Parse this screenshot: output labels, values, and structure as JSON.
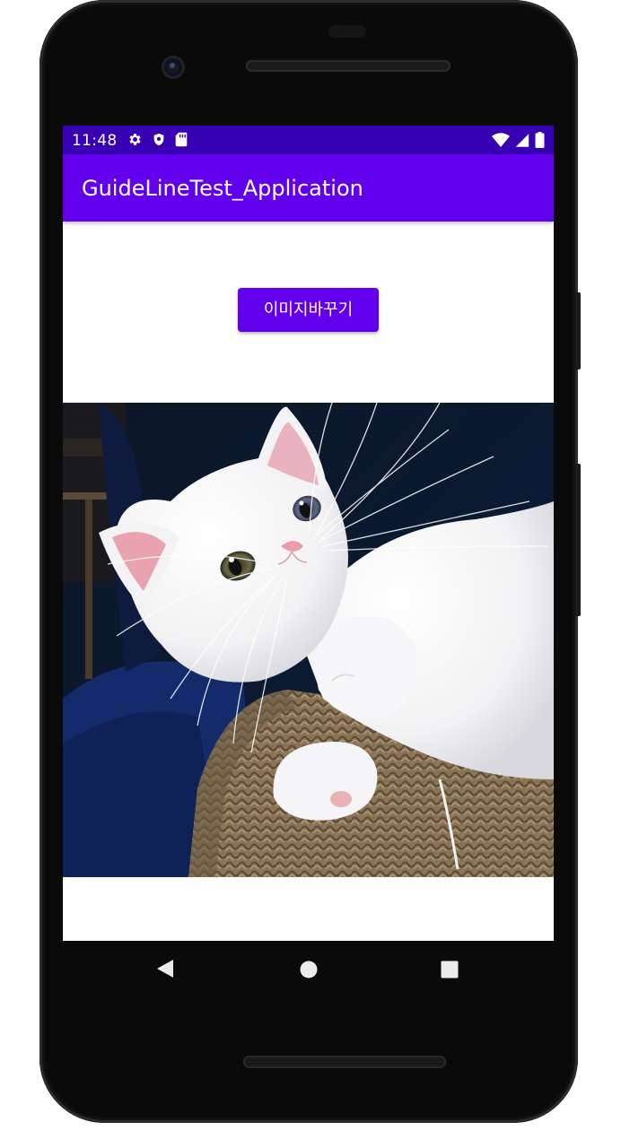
{
  "status_bar": {
    "time": "11:48",
    "left_icons": [
      "settings-icon",
      "shield-icon",
      "sd-card-icon"
    ],
    "right_icons": [
      "wifi-icon",
      "signal-icon",
      "battery-icon"
    ]
  },
  "app_bar": {
    "title": "GuideLineTest_Application"
  },
  "main": {
    "change_image_button": "이미지바꾸기",
    "image": "white-kitten-photo"
  },
  "nav_bar": {
    "buttons": [
      "back-icon",
      "home-icon",
      "recents-icon"
    ]
  },
  "colors": {
    "status_bar": "#3700b3",
    "primary": "#6200ee",
    "background": "#ffffff"
  }
}
